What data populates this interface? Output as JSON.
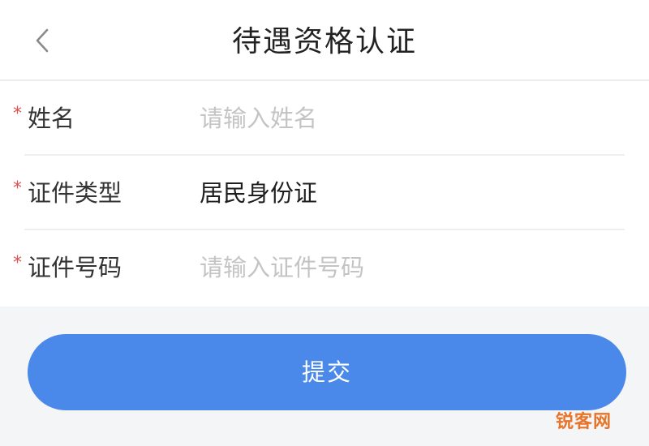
{
  "header": {
    "title": "待遇资格认证",
    "back_icon": "chevron-left-icon"
  },
  "form": {
    "required_mark": "*",
    "fields": [
      {
        "label": "姓名",
        "placeholder": "请输入姓名",
        "value": ""
      },
      {
        "label": "证件类型",
        "value": "居民身份证"
      },
      {
        "label": "证件号码",
        "placeholder": "请输入证件号码",
        "value": ""
      }
    ]
  },
  "submit_label": "提交",
  "watermark": "锐客网",
  "colors": {
    "accent": "#4a88ea",
    "required": "#e05050",
    "placeholder": "#c4c4c4",
    "watermark": "#e8742a"
  }
}
